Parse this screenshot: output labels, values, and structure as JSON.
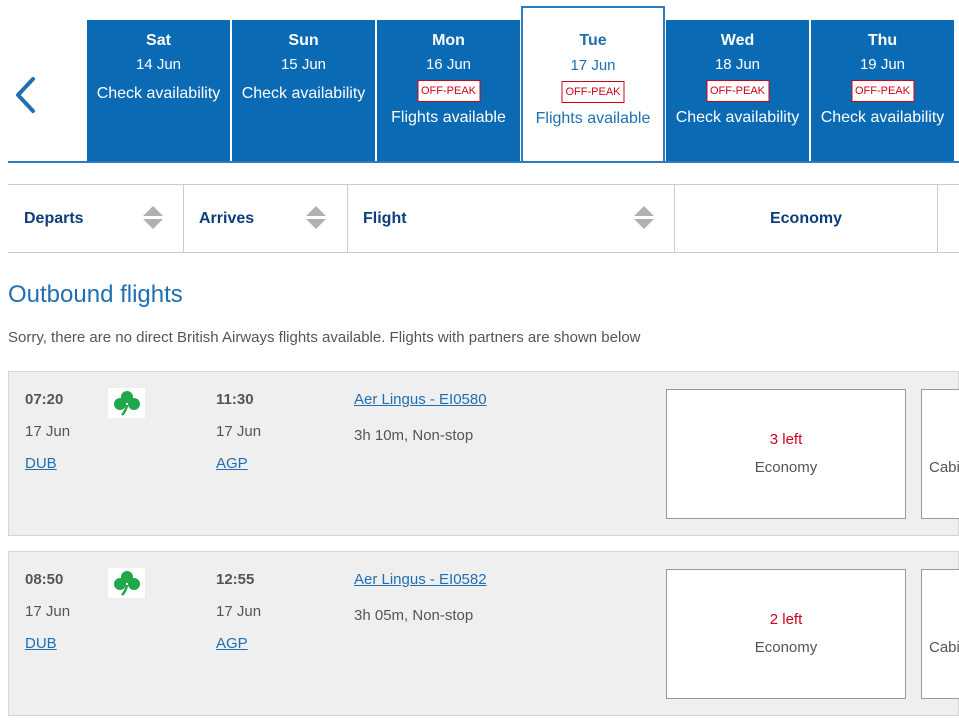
{
  "date_strip": {
    "days": [
      {
        "dow": "Sat",
        "date": "14 Jun",
        "status": "Check availability",
        "badge": ""
      },
      {
        "dow": "Sun",
        "date": "15 Jun",
        "status": "Check availability",
        "badge": ""
      },
      {
        "dow": "Mon",
        "date": "16 Jun",
        "status": "Flights available",
        "badge": "OFF-PEAK"
      },
      {
        "dow": "Tue",
        "date": "17 Jun",
        "status": "Flights available",
        "badge": "OFF-PEAK"
      },
      {
        "dow": "Wed",
        "date": "18 Jun",
        "status": "Check availability",
        "badge": "OFF-PEAK"
      },
      {
        "dow": "Thu",
        "date": "19 Jun",
        "status": "Check availability",
        "badge": "OFF-PEAK"
      }
    ],
    "selected_day": "Tue"
  },
  "sort_header": {
    "departs": "Departs",
    "arrives": "Arrives",
    "flight": "Flight",
    "economy": "Economy"
  },
  "outbound_title": "Outbound flights",
  "notice": "Sorry, there are no direct British Airways flights available. Flights with partners are shown below",
  "flights": [
    {
      "dep_time": "07:20",
      "dep_date": "17 Jun",
      "dep_airport": "DUB",
      "arr_time": "11:30",
      "arr_date": "17 Jun",
      "arr_airport": "AGP",
      "flight": "Aer Lingus - EI0580",
      "duration": "3h 10m, Non-stop",
      "seats_left": "3 left",
      "fare_cabin": "Economy",
      "second_cabin": "Cabi"
    },
    {
      "dep_time": "08:50",
      "dep_date": "17 Jun",
      "dep_airport": "DUB",
      "arr_time": "12:55",
      "arr_date": "17 Jun",
      "arr_airport": "AGP",
      "flight": "Aer Lingus - EI0582",
      "duration": "3h 05m, Non-stop",
      "seats_left": "2 left",
      "fare_cabin": "Economy",
      "second_cabin": "Cabi"
    }
  ],
  "colors": {
    "brand_blue": "#0a6ab4",
    "link_blue": "#1f6fb2",
    "offpeak_red": "#d0021b",
    "shamrock_green": "#1fa84a"
  },
  "icons": {
    "prev": "chevron-left-icon",
    "sort": "sort-icon",
    "airline": "shamrock-icon"
  }
}
